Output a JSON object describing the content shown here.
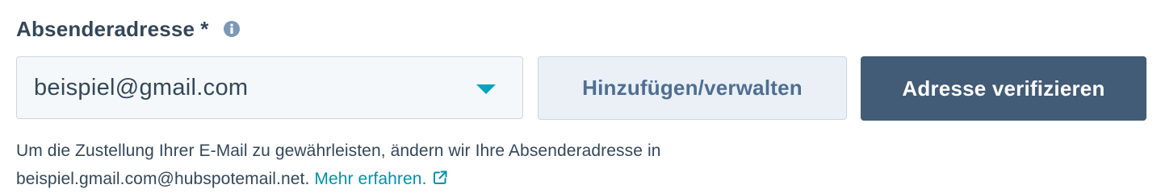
{
  "field": {
    "label": "Absenderadresse",
    "required_marker": "*",
    "info_icon": "info-circle-icon"
  },
  "select": {
    "value": "beispiel@gmail.com",
    "caret_icon": "caret-down-icon",
    "caret_color": "#00a4bd"
  },
  "buttons": {
    "manage_label": "Hinzufügen/verwalten",
    "verify_label": "Adresse verifizieren",
    "verify_bg": "#425b76"
  },
  "help": {
    "line1": "Um die Zustellung Ihrer E-Mail zu gewährleisten, ändern wir Ihre Absenderadresse in",
    "line2_prefix": "beispiel.gmail.com@hubspotemail.net.",
    "link_label": "Mehr erfahren.",
    "link_icon": "external-link-icon",
    "link_color": "#0091ae"
  }
}
